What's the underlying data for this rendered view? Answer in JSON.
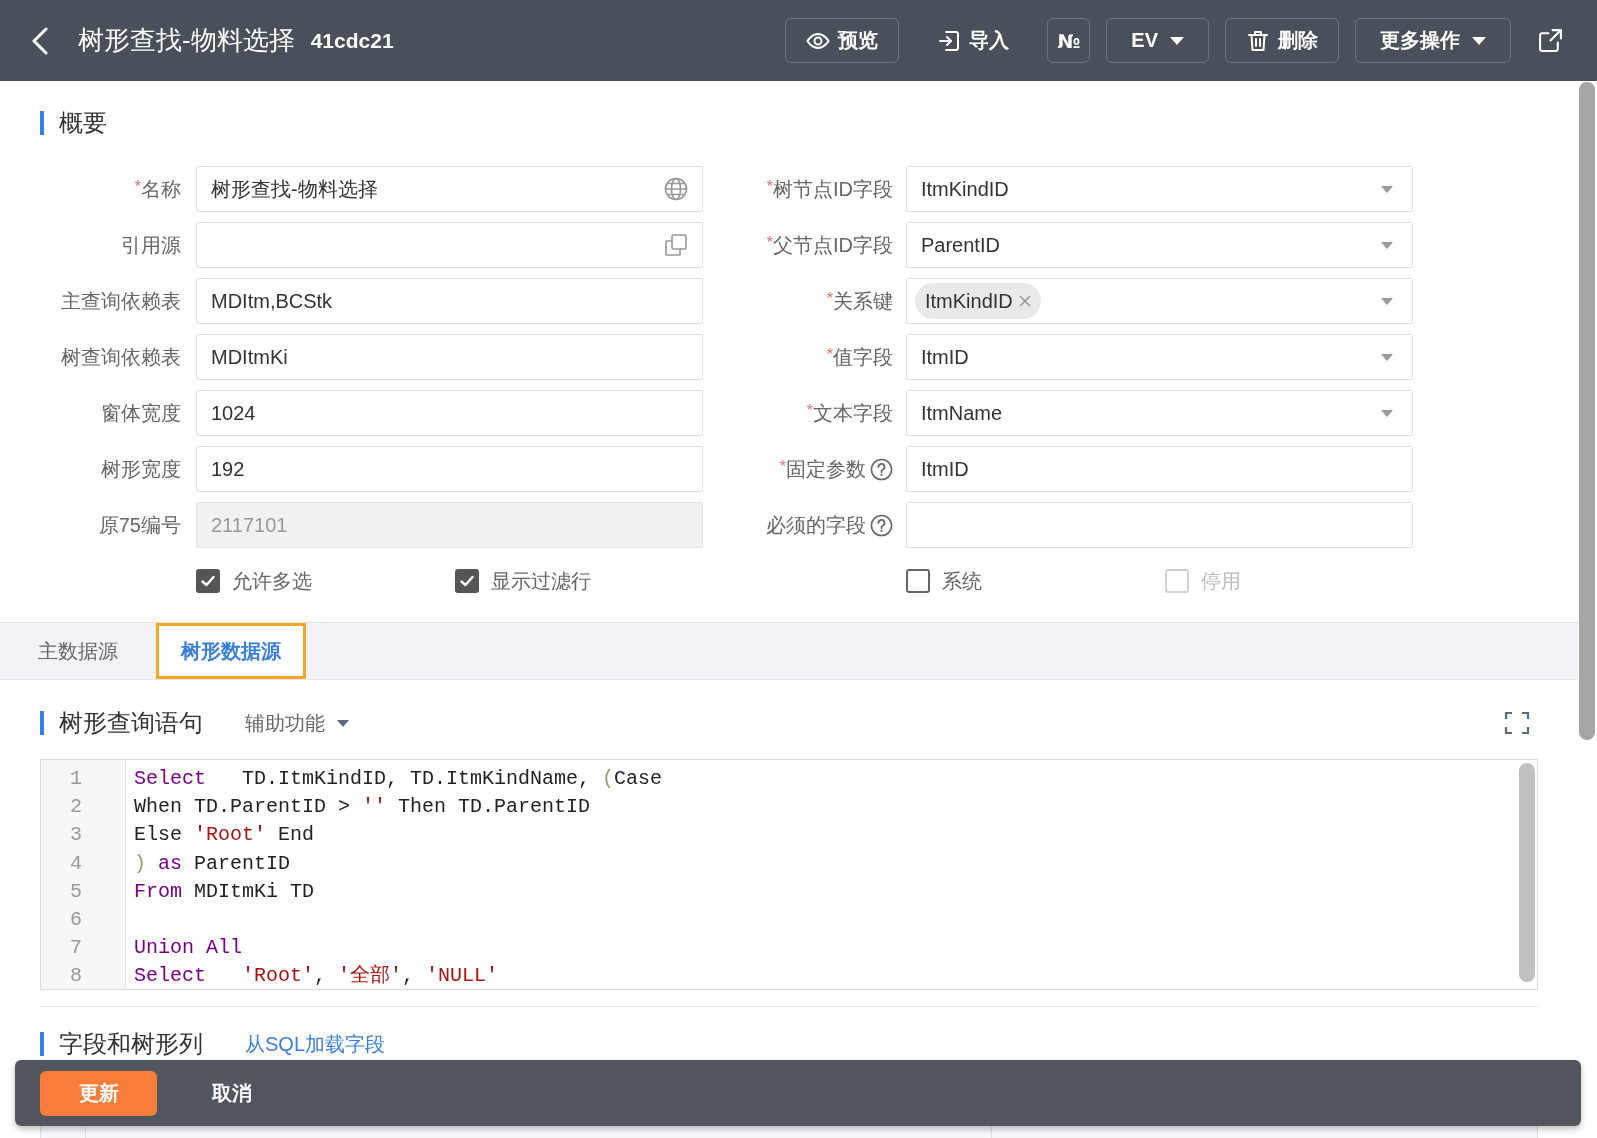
{
  "header": {
    "title": "树形查找-物料选择",
    "code": "41cdc21",
    "actions": [
      {
        "kind": "preview",
        "label": "预览"
      },
      {
        "kind": "import",
        "label": "导入"
      },
      {
        "kind": "number",
        "label": "№"
      },
      {
        "kind": "menu",
        "label": "EV"
      },
      {
        "kind": "delete",
        "label": "删除"
      },
      {
        "kind": "menu",
        "label": "更多操作"
      }
    ]
  },
  "overview": {
    "title": "概要",
    "left_fields": [
      {
        "required_mark": "*",
        "label": "名称",
        "kind": "multilang",
        "value": "树形查找-物料选择",
        "disabled": false
      },
      {
        "label": "引用源",
        "kind": "lookup",
        "disabled": false
      },
      {
        "label": "主查询依赖表",
        "kind": "text",
        "value": "MDItm,BCStk",
        "disabled": false
      },
      {
        "label": "树查询依赖表",
        "kind": "text",
        "value": "MDItmKi",
        "disabled": false
      },
      {
        "label": "窗体宽度",
        "kind": "text",
        "value": "1024",
        "disabled": false
      },
      {
        "label": "树形宽度",
        "kind": "text",
        "value": "192",
        "disabled": false
      },
      {
        "label": "原75编号",
        "kind": "text",
        "value": "2117101",
        "disabled": true
      }
    ],
    "right_fields": [
      {
        "required_mark": "*",
        "label": "树节点ID字段",
        "kind": "select",
        "value": "ItmKindID",
        "help": false
      },
      {
        "required_mark": "*",
        "label": "父节点ID字段",
        "kind": "select",
        "value": "ParentID",
        "help": false
      },
      {
        "required_mark": "*",
        "label": "关系键",
        "kind": "tags",
        "tags": [
          "ItmKindID"
        ],
        "help": false
      },
      {
        "required_mark": "*",
        "label": "值字段",
        "kind": "select",
        "value": "ItmID",
        "help": false
      },
      {
        "required_mark": "*",
        "label": "文本字段",
        "kind": "select",
        "value": "ItmName",
        "help": false
      },
      {
        "required_mark": "*",
        "label": "固定参数",
        "kind": "text",
        "value": "ItmID",
        "help": true
      },
      {
        "label": "必须的字段",
        "kind": "text",
        "help": true
      }
    ],
    "options": [
      {
        "label": "允许多选",
        "checked": true,
        "disabled": false
      },
      {
        "label": "显示过滤行",
        "checked": true,
        "disabled": false
      },
      {
        "label": "系统",
        "checked": false,
        "disabled": false
      },
      {
        "label": "停用",
        "checked": false,
        "disabled": true
      }
    ]
  },
  "tabs": [
    {
      "label": "主数据源",
      "selected": false
    },
    {
      "label": "树形数据源",
      "selected": true
    }
  ],
  "tree_query": {
    "title": "树形查询语句",
    "helper": "辅助功能",
    "code_lines": [
      {
        "number": "1",
        "tokens": [
          {
            "kind": "keyword",
            "text": "Select"
          },
          {
            "kind": "plain",
            "text": "   TD.ItmKindID, TD.ItmKindName, "
          },
          {
            "kind": "bracket",
            "text": "("
          },
          {
            "kind": "plain",
            "text": "Case"
          }
        ]
      },
      {
        "number": "2",
        "tokens": [
          {
            "kind": "plain",
            "text": "When TD.ParentID > "
          },
          {
            "kind": "string",
            "text": "''"
          },
          {
            "kind": "plain",
            "text": " Then TD.ParentID"
          }
        ]
      },
      {
        "number": "3",
        "tokens": [
          {
            "kind": "plain",
            "text": "Else "
          },
          {
            "kind": "string",
            "text": "'Root'"
          },
          {
            "kind": "plain",
            "text": " End"
          }
        ]
      },
      {
        "number": "4",
        "tokens": [
          {
            "kind": "bracket",
            "text": ")"
          },
          {
            "kind": "keyword",
            "text": " as"
          },
          {
            "kind": "plain",
            "text": " ParentID"
          }
        ]
      },
      {
        "number": "5",
        "tokens": [
          {
            "kind": "keyword",
            "text": "From"
          },
          {
            "kind": "plain",
            "text": " MDItmKi TD"
          }
        ]
      },
      {
        "number": "6"
      },
      {
        "number": "7",
        "tokens": [
          {
            "kind": "keyword",
            "text": "Union All"
          }
        ]
      },
      {
        "number": "8",
        "tokens": [
          {
            "kind": "keyword",
            "text": "Select"
          },
          {
            "kind": "string",
            "text": "   'Root'"
          },
          {
            "kind": "plain",
            "text": ", "
          },
          {
            "kind": "string",
            "text": "'全部'"
          },
          {
            "kind": "plain",
            "text": ", "
          },
          {
            "kind": "string",
            "text": "'NULL'"
          }
        ]
      }
    ]
  },
  "fields_section": {
    "title": "字段和树形列",
    "link": "从SQL加载字段"
  },
  "action_bar": {
    "buttons": [
      {
        "kind": "primary",
        "label": "更新"
      },
      {
        "kind": "plain",
        "label": "取消"
      }
    ]
  }
}
